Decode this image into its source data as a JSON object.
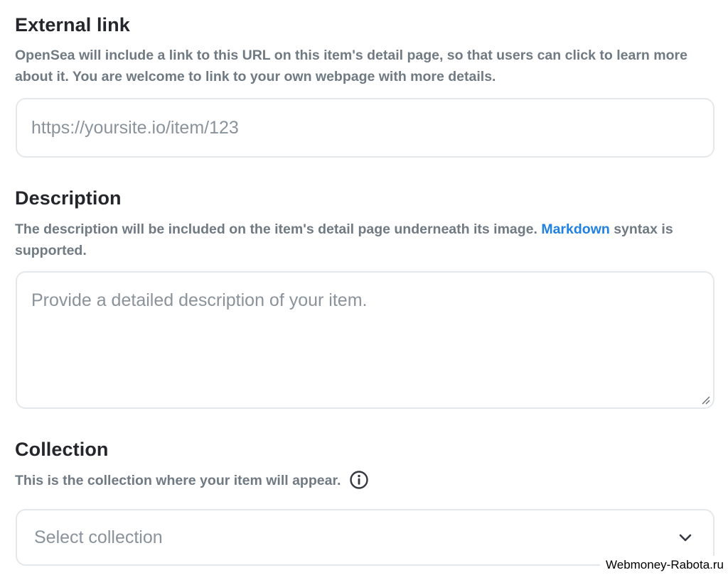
{
  "external_link": {
    "title": "External link",
    "description": "OpenSea will include a link to this URL on this item's detail page, so that users can click to learn more about it. You are welcome to link to your own webpage with more details.",
    "placeholder": "https://yoursite.io/item/123",
    "value": ""
  },
  "description": {
    "title": "Description",
    "text_before_link": "The description will be included on the item's detail page underneath its image. ",
    "link_label": "Markdown",
    "text_after_link": " syntax is supported.",
    "placeholder": "Provide a detailed description of your item.",
    "value": ""
  },
  "collection": {
    "title": "Collection",
    "description": "This is the collection where your item will appear.",
    "select_placeholder": "Select collection",
    "info_icon": "info-circle-icon",
    "chevron_icon": "chevron-down-icon"
  },
  "watermark": {
    "text": "Webmoney-Rabota.ru"
  },
  "colors": {
    "heading": "#24262b",
    "muted_text": "#707a83",
    "placeholder": "#8a939b",
    "link": "#2081e2",
    "border": "#e5e8eb"
  }
}
